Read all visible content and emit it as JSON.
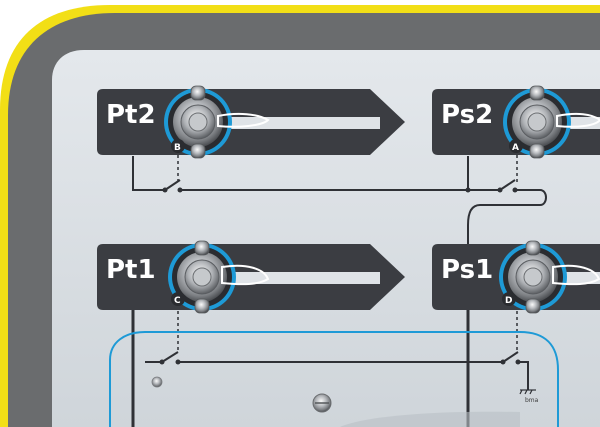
{
  "colors": {
    "case_yellow": "#f2df16",
    "case_gray": "#6e6e6e",
    "panel_light": "#d9dee3",
    "label_dark": "#3b3d42",
    "connector_blue": "#1e9ad6",
    "line_dark": "#2f3136"
  },
  "ports": [
    {
      "id": "pt2",
      "label": "Pt2",
      "letter": "B"
    },
    {
      "id": "ps2",
      "label": "Ps2",
      "letter": "A"
    },
    {
      "id": "pt1",
      "label": "Pt1",
      "letter": "C"
    },
    {
      "id": "ps1",
      "label": "Ps1",
      "letter": "D"
    }
  ],
  "bottom_right_symbol_text": "bma"
}
